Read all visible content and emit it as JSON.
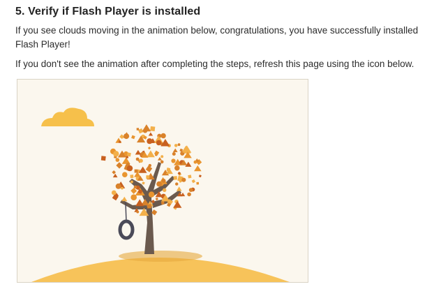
{
  "section": {
    "title": "5. Verify if Flash Player is installed",
    "paragraphs": [
      "If you see clouds moving in the animation below, congratulations, you have successfully installed Flash Player!",
      "If you don't see the animation after completing the steps, refresh this page using the icon below."
    ]
  },
  "animation": {
    "colors": {
      "background": "#fbf7ee",
      "hill": "#f7c35a",
      "cloud": "#f6c04b",
      "trunk": "#6b5a4e",
      "tire": "#4a4a58",
      "leaf_dark": "#d9822b",
      "leaf_light": "#f3b04a"
    },
    "elements": [
      "cloud",
      "tree",
      "tire-swing",
      "hill"
    ]
  }
}
